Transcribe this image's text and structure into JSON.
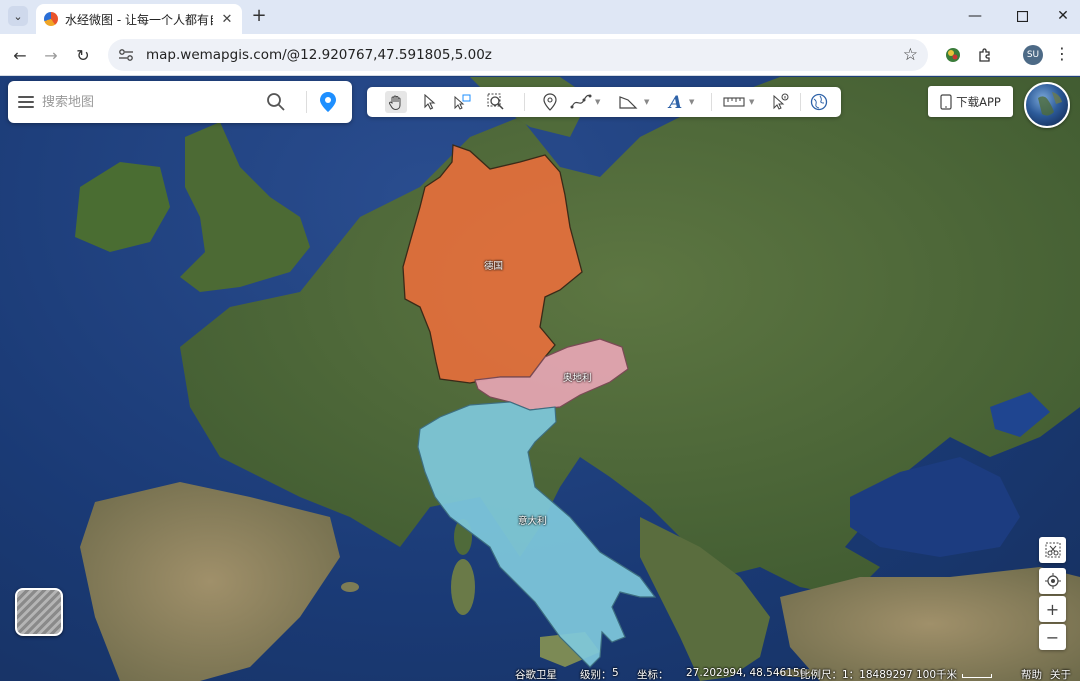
{
  "browser": {
    "tab_title": "水经微图 - 让每一个人都有自己",
    "url": "map.wemapgis.com/@12.920767,47.591805,5.00z",
    "profile_initials": "SU"
  },
  "search": {
    "placeholder": "搜索地图"
  },
  "toolbar": {
    "tools": [
      "hand-icon",
      "pointer-icon",
      "select-box-icon",
      "zoom-region-icon",
      "marker-icon",
      "polyline-icon",
      "polygon-icon",
      "text-icon",
      "ruler-icon",
      "pointer-info-icon",
      "globe-icon"
    ]
  },
  "download": {
    "label": "下载APP"
  },
  "regions": {
    "germany": {
      "label": "德国",
      "color": "#e56f3c"
    },
    "austria": {
      "label": "奥地利",
      "color": "#e7a6b4"
    },
    "italy": {
      "label": "意大利",
      "color": "#7fc9dc"
    }
  },
  "status": {
    "layer": "谷歌卫星",
    "level_label": "级别：",
    "level": "5",
    "coord_label": "坐标：",
    "coord": "27.202994, 48.546156",
    "scale_label": "比例尺：",
    "scale": "1：18489297",
    "distance": "100千米",
    "help": "帮助",
    "about": "关于"
  },
  "colors": {
    "ocean": "#1d3f7a",
    "land": "#4f6b3a",
    "accent": "#1e8fff"
  }
}
